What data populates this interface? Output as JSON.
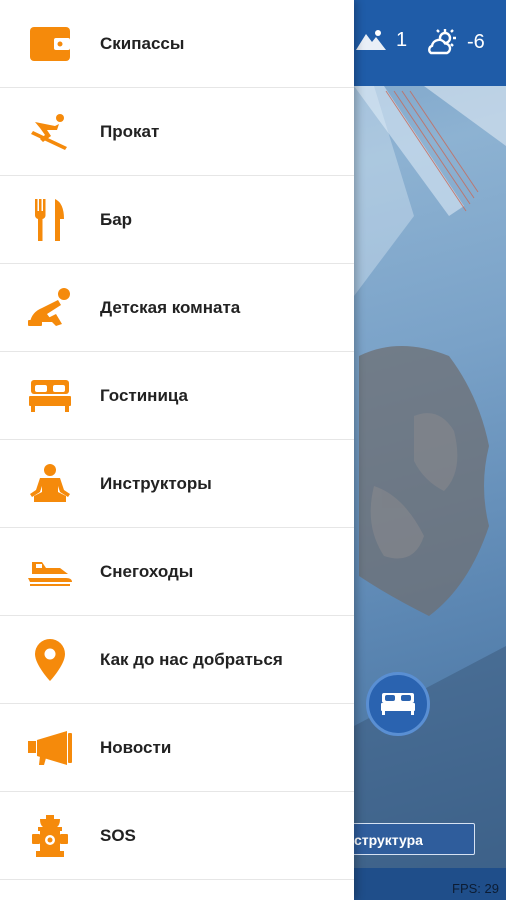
{
  "colors": {
    "accent": "#f58a0b",
    "app_blue": "#1f5ca8"
  },
  "menu": {
    "items": [
      {
        "label": "Скипассы",
        "icon": "wallet-icon"
      },
      {
        "label": "Прокат",
        "icon": "skier-icon"
      },
      {
        "label": "Бар",
        "icon": "fork-knife-icon"
      },
      {
        "label": "Детская комната",
        "icon": "child-play-icon"
      },
      {
        "label": "Гостиница",
        "icon": "bed-icon"
      },
      {
        "label": "Инструкторы",
        "icon": "meditation-person-icon"
      },
      {
        "label": "Снегоходы",
        "icon": "snowmobile-icon"
      },
      {
        "label": "Как до нас добраться",
        "icon": "location-pin-icon"
      },
      {
        "label": "Новости",
        "icon": "megaphone-icon"
      },
      {
        "label": "SOS",
        "icon": "fire-hydrant-icon"
      }
    ]
  },
  "background": {
    "lifts_count": "1",
    "temperature": "-6",
    "infrastructure_label": "структура",
    "fps_text": "FPS: 29"
  }
}
